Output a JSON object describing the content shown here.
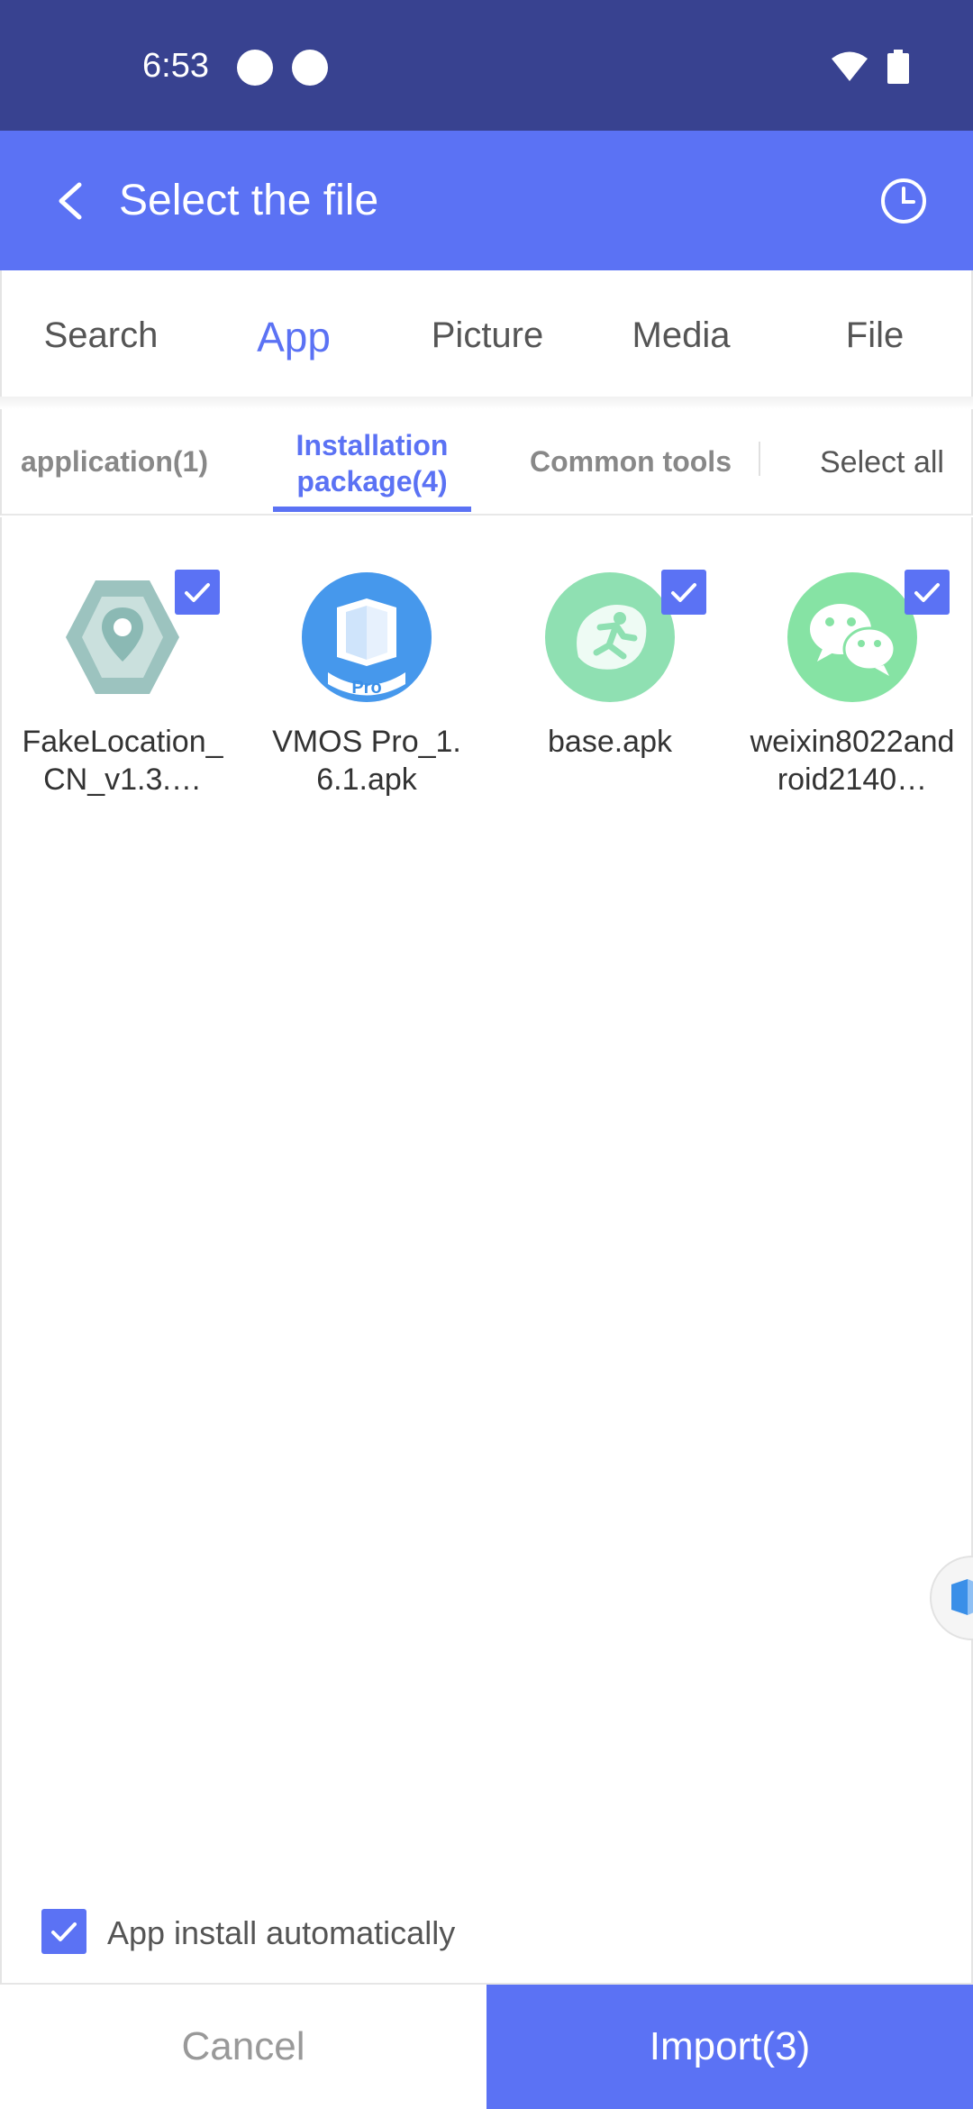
{
  "status_bar": {
    "time": "6:53",
    "icons": [
      "dot-icon",
      "dot-icon",
      "wifi-icon",
      "battery-icon"
    ]
  },
  "header": {
    "title": "Select the file",
    "back_icon": "back-arrow-icon",
    "history_icon": "clock-icon",
    "color": "#5b72f4"
  },
  "main_tabs": [
    {
      "label": "Search",
      "active": false
    },
    {
      "label": "App",
      "active": true
    },
    {
      "label": "Picture",
      "active": false
    },
    {
      "label": "Media",
      "active": false
    },
    {
      "label": "File",
      "active": false
    }
  ],
  "sub_tabs": [
    {
      "label": "application(1)",
      "active": false
    },
    {
      "label_line1": "Installation",
      "label_line2": "package(4)",
      "active": true
    },
    {
      "label": "Common tools",
      "active": false
    }
  ],
  "select_all_label": "Select all",
  "files": [
    {
      "name": "FakeLocation_CN_v1.3.…",
      "icon": "fakelocation-app-icon",
      "checked": true
    },
    {
      "name": "VMOS Pro_1.6.1.apk",
      "icon": "vmos-pro-app-icon",
      "checked": false
    },
    {
      "name": "base.apk",
      "icon": "runner-app-icon",
      "checked": true
    },
    {
      "name": "weixin8022android2140…",
      "icon": "wechat-app-icon",
      "checked": true
    }
  ],
  "floating_icon": "vmos-float-icon",
  "auto_install": {
    "label": "App install automatically",
    "checked": true
  },
  "buttons": {
    "cancel": "Cancel",
    "import": "Import(3)"
  },
  "colors": {
    "accent": "#5b72f4",
    "status_bar": "#384290"
  }
}
